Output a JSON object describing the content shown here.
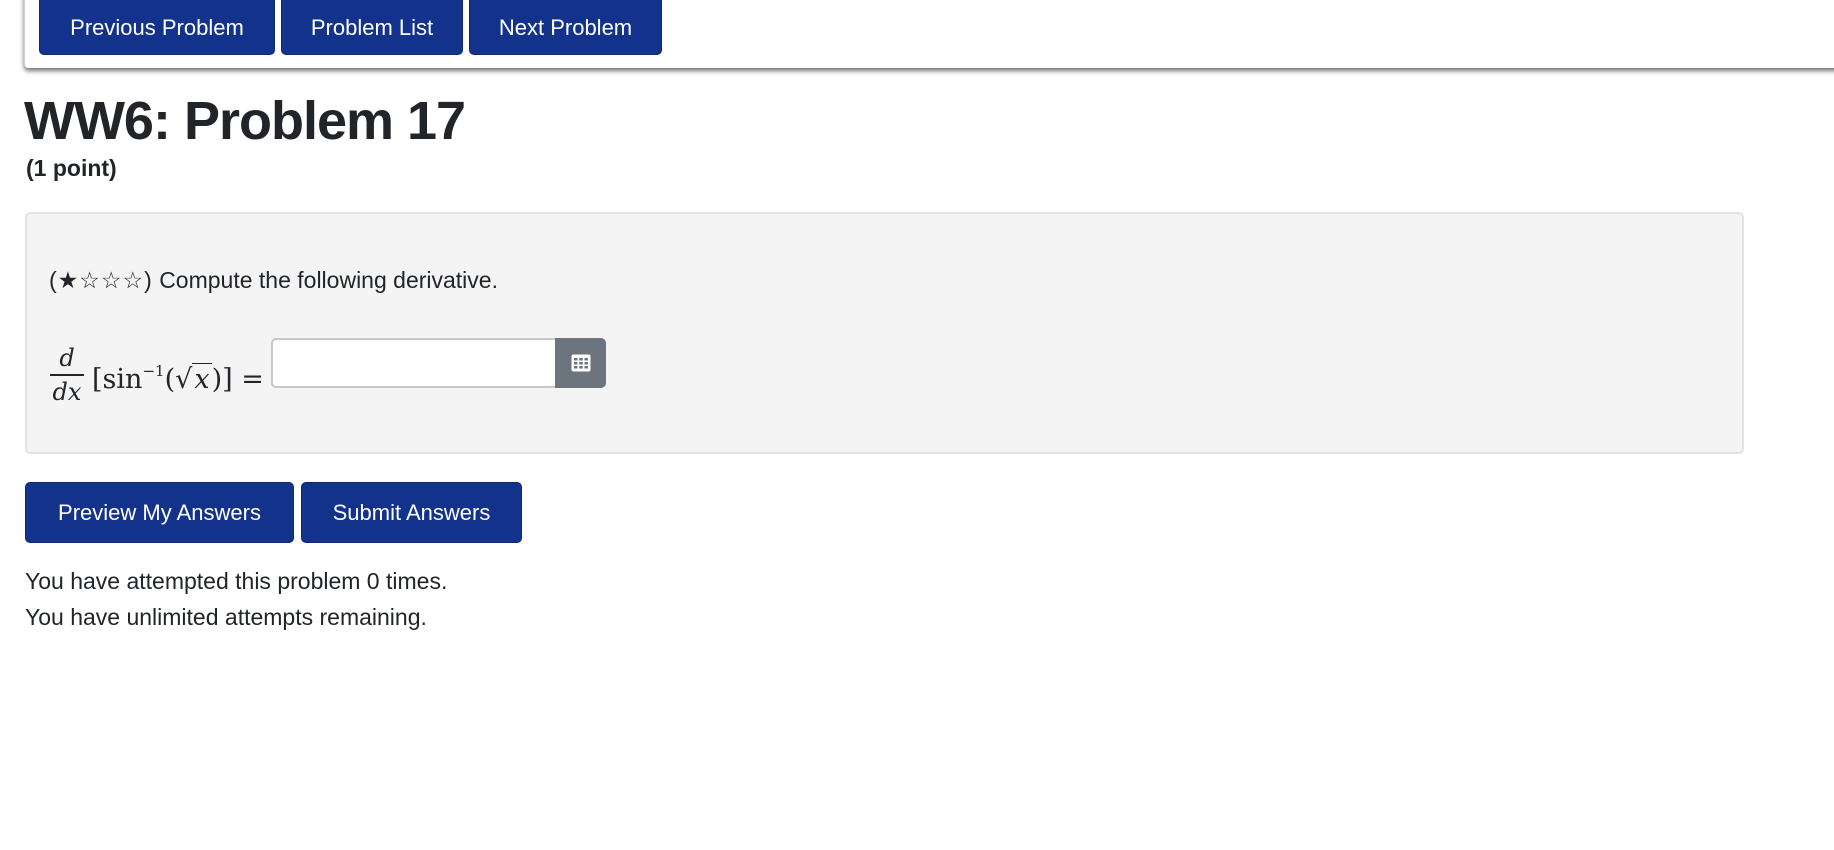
{
  "nav": {
    "previous_label": "Previous Problem",
    "list_label": "Problem List",
    "next_label": "Next Problem"
  },
  "problem": {
    "title": "WW6: Problem 17",
    "points": "(1 point)",
    "difficulty_stars": "(★☆☆☆)",
    "instruction": "Compute the following derivative.",
    "math": {
      "numerator": "d",
      "denominator": "dx",
      "open_bracket": "[",
      "function": "sin",
      "exponent": "−1",
      "open_paren": "(",
      "radical": "√",
      "variable": "x",
      "close_paren": ")",
      "close_bracket": "]",
      "equals": "="
    },
    "answer_value": "",
    "answer_placeholder": ""
  },
  "icons": {
    "equation_editor": "grid-calculator-icon"
  },
  "actions": {
    "preview_label": "Preview My Answers",
    "submit_label": "Submit Answers"
  },
  "status": {
    "attempts": "You have attempted this problem 0 times.",
    "remaining": "You have unlimited attempts remaining."
  },
  "colors": {
    "primary_button": "#13328c",
    "equation_button": "#6c757d",
    "problem_background": "#f4f4f4"
  }
}
